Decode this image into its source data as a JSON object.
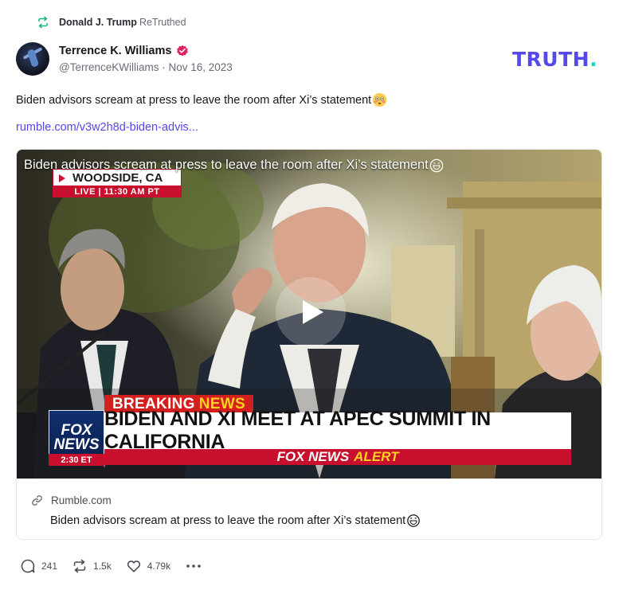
{
  "retruth": {
    "name": "Donald J. Trump",
    "suffix": "ReTruthed",
    "icon": "retruth-icon"
  },
  "author": {
    "display_name": "Terrence K. Williams",
    "handle": "@TerrenceKWilliams",
    "date": "Nov 16, 2023",
    "verified": true
  },
  "brand": {
    "logo_text": "TRUTH",
    "logo_dot": ".",
    "accent_color": "#5448ee",
    "dot_color": "#1fd2c3"
  },
  "post": {
    "text": "Biden advisors scream at press to leave the room after Xi’s statement",
    "text_emoji": "flushed-face-emoji",
    "link": "rumble.com/v3w2h8d-biden-advis..."
  },
  "video": {
    "title": "Biden advisors scream at press to leave the room after Xi’s statement",
    "title_emoji": "grinning-sweat-emoji",
    "location": "WOODSIDE, CA",
    "live_time": "LIVE | 11:30 AM PT",
    "breaking_label": "BREAKING",
    "breaking_news": "NEWS",
    "headline": "BIDEN AND XI MEET AT APEC SUMMIT IN CALIFORNIA",
    "alert_prefix": "FOX NEWS",
    "alert_word": "ALERT",
    "fox_logo_line1": "FOX",
    "fox_logo_line2": "NEWS",
    "fox_time": "2:30 ET"
  },
  "card": {
    "source": "Rumble.com",
    "title": "Biden advisors scream at press to leave the room after Xi’s statement"
  },
  "actions": {
    "replies": "241",
    "retruths": "1.5k",
    "likes": "4.79k"
  }
}
